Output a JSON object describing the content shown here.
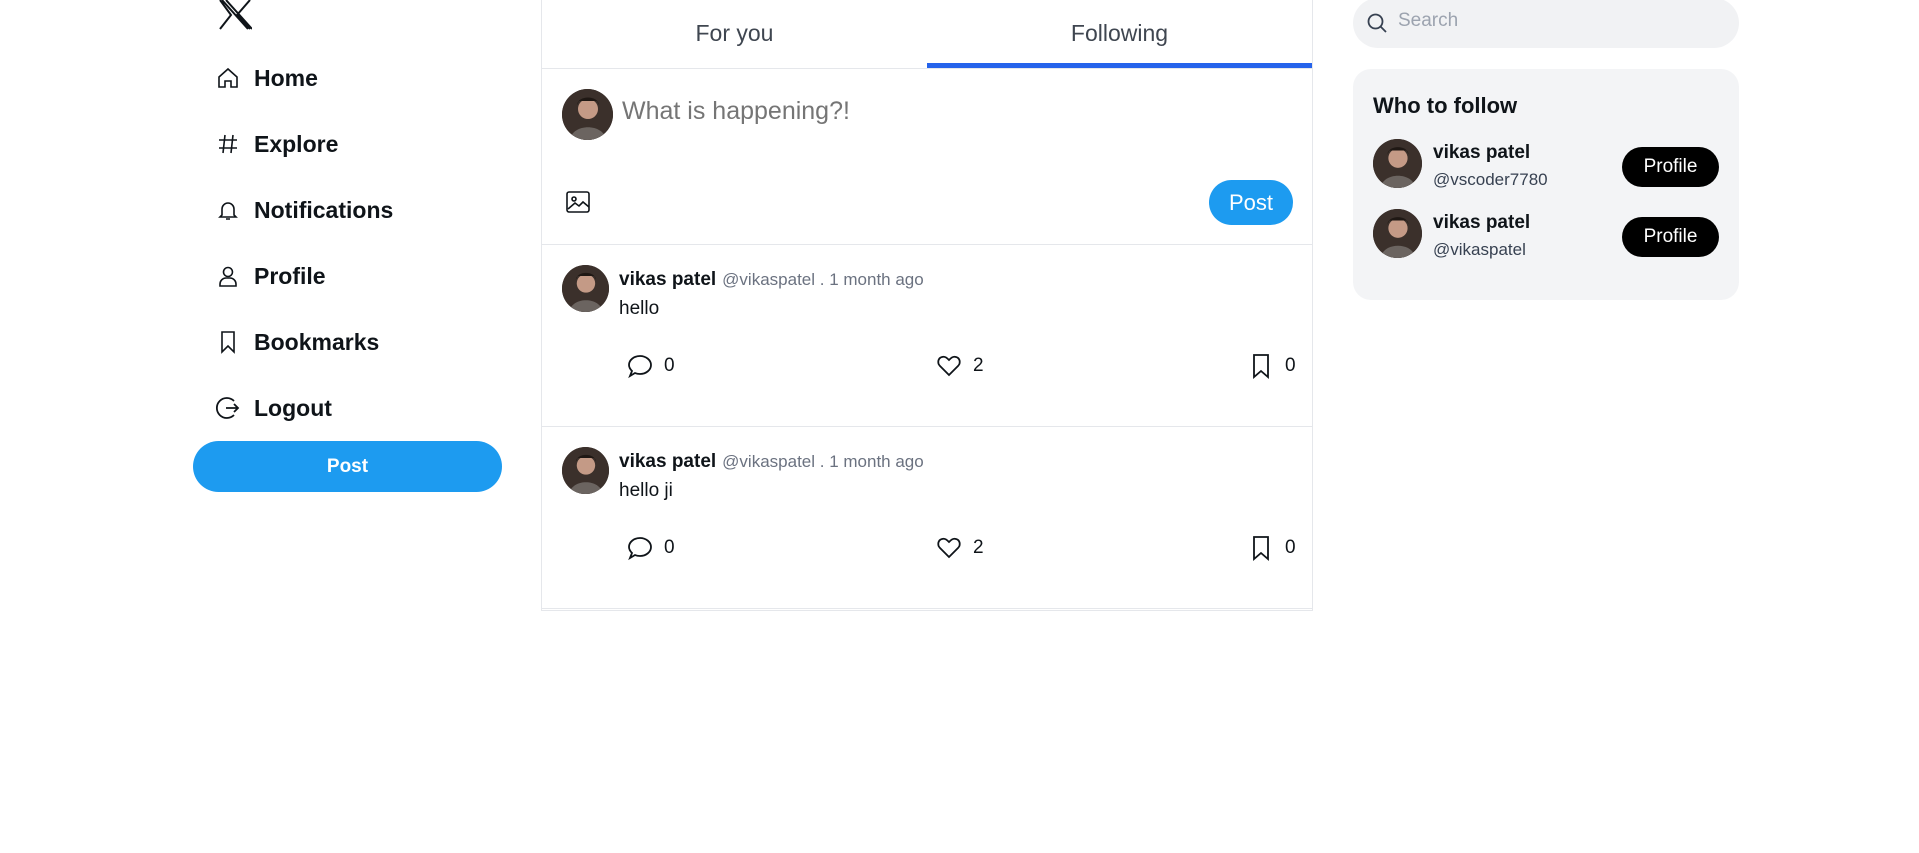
{
  "sidebar": {
    "logo_icon": "x-logo-icon",
    "items": [
      {
        "label": "Home",
        "icon": "home-icon"
      },
      {
        "label": "Explore",
        "icon": "hash-icon"
      },
      {
        "label": "Notifications",
        "icon": "bell-icon"
      },
      {
        "label": "Profile",
        "icon": "user-icon"
      },
      {
        "label": "Bookmarks",
        "icon": "bookmark-icon"
      },
      {
        "label": "Logout",
        "icon": "logout-icon"
      }
    ],
    "post_label": "Post"
  },
  "feed": {
    "tabs": [
      {
        "label": "For you",
        "active": false
      },
      {
        "label": "Following",
        "active": true
      }
    ],
    "composer": {
      "placeholder": "What is happening?!",
      "post_label": "Post"
    },
    "tweets": [
      {
        "name": "vikas patel",
        "meta": "@vikaspatel . 1 month ago",
        "text": "hello",
        "replies": "0",
        "likes": "2",
        "bookmarks": "0"
      },
      {
        "name": "vikas patel",
        "meta": "@vikaspatel . 1 month ago",
        "text": "hello ji",
        "replies": "0",
        "likes": "2",
        "bookmarks": "0"
      }
    ]
  },
  "right": {
    "search_placeholder": "Search",
    "who_to_follow": {
      "title": "Who to follow",
      "users": [
        {
          "name": "vikas patel",
          "handle": "@vscoder7780",
          "button": "Profile"
        },
        {
          "name": "vikas patel",
          "handle": "@vikaspatel",
          "button": "Profile"
        }
      ]
    }
  },
  "colors": {
    "accent": "#1d9bf0",
    "tab_indicator": "#2563eb",
    "panel_bg": "#f3f4f6"
  }
}
